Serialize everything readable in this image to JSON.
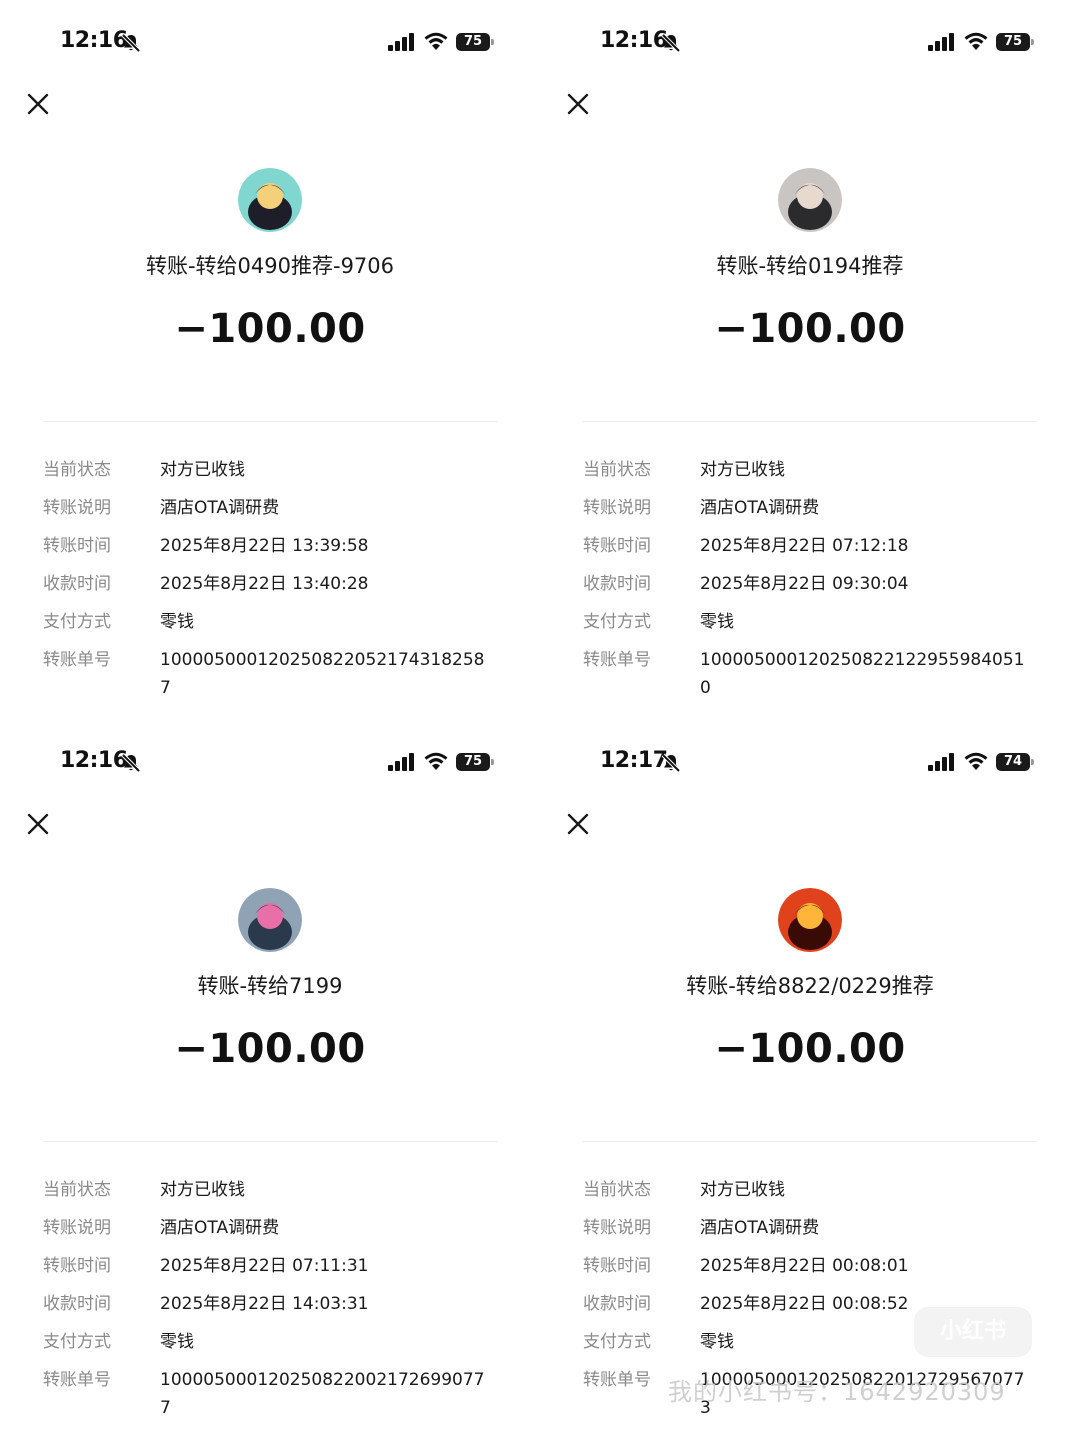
{
  "panels": [
    {
      "status_time": "12:16",
      "battery": "75",
      "avatar_colors": [
        "#7fd7d0",
        "#1e1e2a",
        "#f4d07a"
      ],
      "title": "转账-转给0490推荐-9706",
      "amount": "−100.00",
      "details": [
        {
          "label": "当前状态",
          "value": "对方已收钱"
        },
        {
          "label": "转账说明",
          "value": "酒店OTA调研费"
        },
        {
          "label": "转账时间",
          "value": "2025年8月22日 13:39:58"
        },
        {
          "label": "收款时间",
          "value": "2025年8月22日 13:40:28"
        },
        {
          "label": "支付方式",
          "value": "零钱"
        },
        {
          "label": "转账单号",
          "value": "100005000120250822052174318258 7"
        }
      ]
    },
    {
      "status_time": "12:16",
      "battery": "75",
      "avatar_colors": [
        "#c9c5c2",
        "#2b2b2e",
        "#e8d9cf"
      ],
      "title": "转账-转给0194推荐",
      "amount": "−100.00",
      "details": [
        {
          "label": "当前状态",
          "value": "对方已收钱"
        },
        {
          "label": "转账说明",
          "value": "酒店OTA调研费"
        },
        {
          "label": "转账时间",
          "value": "2025年8月22日 07:12:18"
        },
        {
          "label": "收款时间",
          "value": "2025年8月22日 09:30:04"
        },
        {
          "label": "支付方式",
          "value": "零钱"
        },
        {
          "label": "转账单号",
          "value": "100005000120250822122955984051 0"
        }
      ]
    },
    {
      "status_time": "12:16",
      "battery": "75",
      "avatar_colors": [
        "#8fa3b5",
        "#2a3a4c",
        "#e86fa8"
      ],
      "title": "转账-转给7199",
      "amount": "−100.00",
      "details": [
        {
          "label": "当前状态",
          "value": "对方已收钱"
        },
        {
          "label": "转账说明",
          "value": "酒店OTA调研费"
        },
        {
          "label": "转账时间",
          "value": "2025年8月22日 07:11:31"
        },
        {
          "label": "收款时间",
          "value": "2025年8月22日 14:03:31"
        },
        {
          "label": "支付方式",
          "value": "零钱"
        },
        {
          "label": "转账单号",
          "value": "100005000120250822002172699077 7"
        }
      ]
    },
    {
      "status_time": "12:17",
      "battery": "74",
      "avatar_colors": [
        "#e0421b",
        "#3a0a05",
        "#ffb43a"
      ],
      "title": "转账-转给8822/0229推荐",
      "amount": "−100.00",
      "details": [
        {
          "label": "当前状态",
          "value": "对方已收钱"
        },
        {
          "label": "转账说明",
          "value": "酒店OTA调研费"
        },
        {
          "label": "转账时间",
          "value": "2025年8月22日 00:08:01"
        },
        {
          "label": "收款时间",
          "value": "2025年8月22日 00:08:52"
        },
        {
          "label": "支付方式",
          "value": "零钱"
        },
        {
          "label": "转账单号",
          "value": "100005000120250822012729567077 3"
        }
      ]
    }
  ],
  "watermark": {
    "text": "我的小红书号：1642920309",
    "logo": "小红书"
  }
}
